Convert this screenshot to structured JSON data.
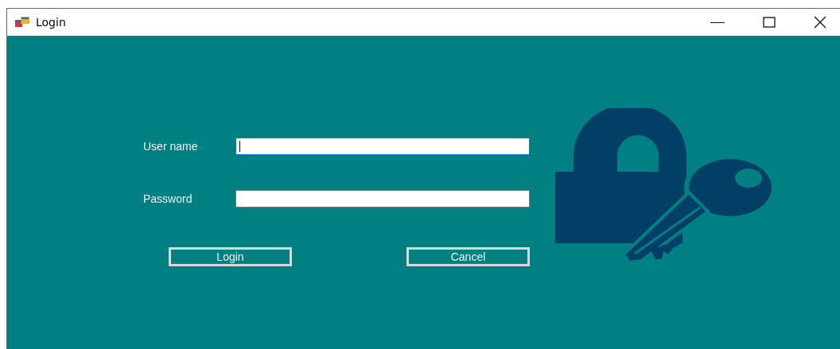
{
  "window": {
    "title": "Login"
  },
  "fields": [
    {
      "label": "User name",
      "focused": true
    },
    {
      "label": "Password",
      "focused": false
    }
  ],
  "buttons": [
    "Login",
    "Cancel"
  ]
}
